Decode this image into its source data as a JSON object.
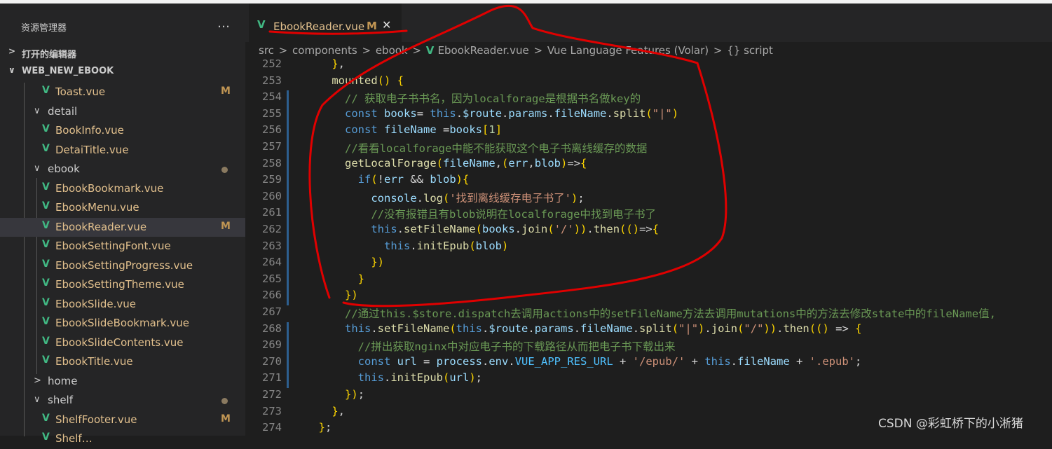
{
  "explorer": {
    "title": "资源管理器",
    "more_icon": "…",
    "open_editors": "打开的编辑器",
    "project": "WEB_NEW_EBOOK",
    "items": [
      {
        "name": "Toast.vue",
        "depth": 2,
        "type": "file",
        "badge": "M"
      },
      {
        "name": "detail",
        "depth": 1,
        "type": "folder",
        "open": true
      },
      {
        "name": "BookInfo.vue",
        "depth": 2,
        "type": "file"
      },
      {
        "name": "DetaiTitle.vue",
        "depth": 2,
        "type": "file"
      },
      {
        "name": "ebook",
        "depth": 1,
        "type": "folder",
        "open": true,
        "dot": true
      },
      {
        "name": "EbookBookmark.vue",
        "depth": 2,
        "type": "file"
      },
      {
        "name": "EbookMenu.vue",
        "depth": 2,
        "type": "file"
      },
      {
        "name": "EbookReader.vue",
        "depth": 2,
        "type": "file",
        "badge": "M",
        "selected": true
      },
      {
        "name": "EbookSettingFont.vue",
        "depth": 2,
        "type": "file"
      },
      {
        "name": "EbookSettingProgress.vue",
        "depth": 2,
        "type": "file"
      },
      {
        "name": "EbookSettingTheme.vue",
        "depth": 2,
        "type": "file"
      },
      {
        "name": "EbookSlide.vue",
        "depth": 2,
        "type": "file"
      },
      {
        "name": "EbookSlideBookmark.vue",
        "depth": 2,
        "type": "file"
      },
      {
        "name": "EbookSlideContents.vue",
        "depth": 2,
        "type": "file"
      },
      {
        "name": "EbookTitle.vue",
        "depth": 2,
        "type": "file"
      },
      {
        "name": "home",
        "depth": 1,
        "type": "folder",
        "open": false
      },
      {
        "name": "shelf",
        "depth": 1,
        "type": "folder",
        "open": true,
        "dot": true
      },
      {
        "name": "ShelfFooter.vue",
        "depth": 2,
        "type": "file",
        "badge": "M"
      },
      {
        "name": "Shelf…",
        "depth": 2,
        "type": "file"
      }
    ]
  },
  "tab": {
    "name": "EbookReader.vue",
    "badge": "M",
    "close": "✕"
  },
  "breadcrumb": [
    "src",
    "components",
    "ebook",
    "EbookReader.vue",
    "Vue Language Features (Volar)",
    "{} script"
  ],
  "code": [
    {
      "n": "252",
      "t": "    },",
      "m": false
    },
    {
      "n": "253",
      "t": "    mounted() {",
      "m": false
    },
    {
      "n": "254",
      "t": "      // 获取电子书书名，因为localforage是根据书名做key的",
      "m": true
    },
    {
      "n": "255",
      "t": "      const books= this.$route.params.fileName.split(\"|\")",
      "m": true
    },
    {
      "n": "256",
      "t": "      const fileName =books[1]",
      "m": true
    },
    {
      "n": "257",
      "t": "      //看看localforage中能不能获取这个电子书离线缓存的数据",
      "m": true
    },
    {
      "n": "258",
      "t": "      getLocalForage(fileName,(err,blob)=>{",
      "m": true
    },
    {
      "n": "259",
      "t": "        if(!err && blob){",
      "m": true
    },
    {
      "n": "260",
      "t": "          console.log('找到离线缓存电子书了');",
      "m": true
    },
    {
      "n": "261",
      "t": "          //没有报错且有blob说明在localforage中找到电子书了",
      "m": true
    },
    {
      "n": "262",
      "t": "          this.setFileName(books.join('/')).then(()=>{",
      "m": true
    },
    {
      "n": "263",
      "t": "            this.initEpub(blob)",
      "m": true
    },
    {
      "n": "264",
      "t": "          })",
      "m": true
    },
    {
      "n": "265",
      "t": "        }",
      "m": true
    },
    {
      "n": "266",
      "t": "      })",
      "m": true
    },
    {
      "n": "267",
      "t": "      //通过this.$store.dispatch去调用actions中的setFileName方法去调用mutations中的方法去修改state中的fileName值,",
      "m": false
    },
    {
      "n": "268",
      "t": "      this.setFileName(this.$route.params.fileName.split(\"|\").join(\"/\")).then(() => {",
      "m": true
    },
    {
      "n": "269",
      "t": "        //拼出获取nginx中对应电子书的下载路径从而把电子书下载出来",
      "m": true
    },
    {
      "n": "270",
      "t": "        const url = process.env.VUE_APP_RES_URL + '/epub/' + this.fileName + '.epub';",
      "m": true
    },
    {
      "n": "271",
      "t": "        this.initEpub(url);",
      "m": true
    },
    {
      "n": "272",
      "t": "      });",
      "m": false
    },
    {
      "n": "273",
      "t": "    },",
      "m": false
    },
    {
      "n": "274",
      "t": "  };",
      "m": false
    }
  ],
  "watermark": "CSDN @彩虹桥下的小淅猪",
  "colors": {
    "vue_icon": "#41b883",
    "modified": "#c09553",
    "annotation": "#e00000"
  }
}
